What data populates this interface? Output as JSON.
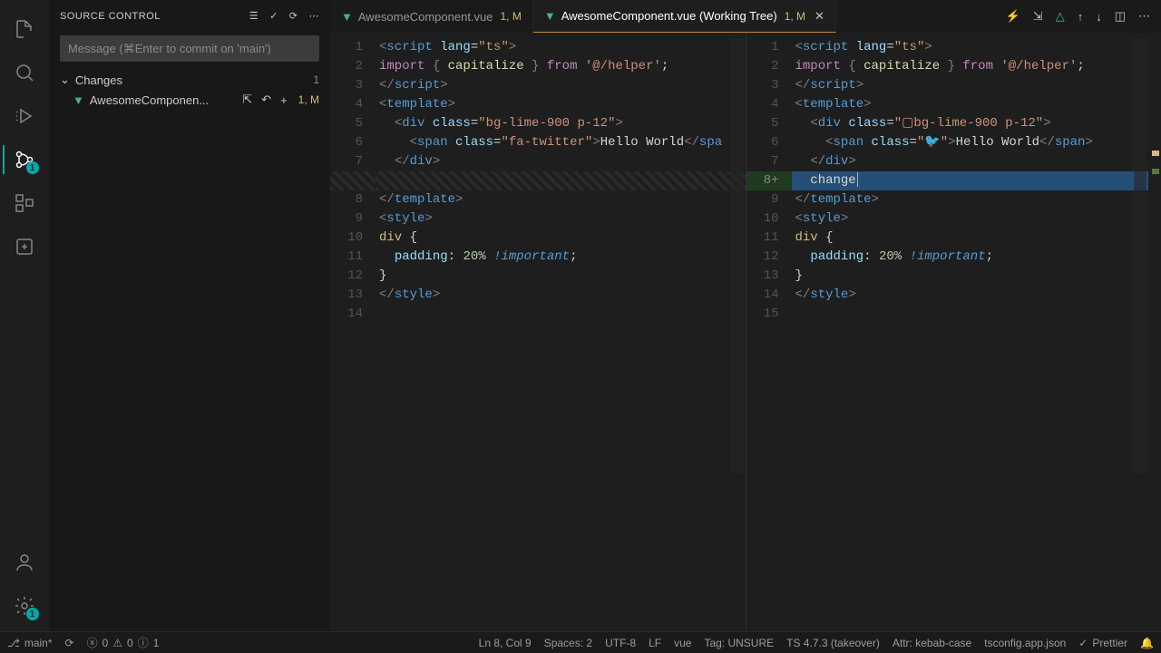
{
  "sidebar": {
    "title": "SOURCE CONTROL",
    "commit_placeholder": "Message (⌘Enter to commit on 'main')",
    "section_label": "Changes",
    "section_count": "1",
    "file_name": "AwesomeComponen...",
    "file_badges": "1, M"
  },
  "tabs": {
    "left": {
      "name": "AwesomeComponent.vue",
      "badges": "1, M"
    },
    "right": {
      "name": "AwesomeComponent.vue (Working Tree)",
      "badges": "1, M"
    }
  },
  "linenos_left": [
    "1",
    "2",
    "3",
    "4",
    "5",
    "6",
    "7",
    "",
    "8",
    "9",
    "10",
    "11",
    "12",
    "13",
    "14"
  ],
  "linenos_right": [
    "1",
    "2",
    "3",
    "4",
    "5",
    "6",
    "7",
    "8+",
    "9",
    "10",
    "11",
    "12",
    "13",
    "14",
    "15"
  ],
  "code_left": {
    "l1": [
      {
        "c": "br",
        "t": "<"
      },
      {
        "c": "tag",
        "t": "script "
      },
      {
        "c": "attr",
        "t": "lang"
      },
      {
        "c": "op",
        "t": "="
      },
      {
        "c": "str",
        "t": "\"ts\""
      },
      {
        "c": "br",
        "t": ">"
      }
    ],
    "l2": [
      {
        "c": "kw",
        "t": "import "
      },
      {
        "c": "br",
        "t": "{ "
      },
      {
        "c": "fn",
        "t": "capitalize"
      },
      {
        "c": "br",
        "t": " } "
      },
      {
        "c": "kw",
        "t": "from "
      },
      {
        "c": "str",
        "t": "'@/helper'"
      },
      {
        "c": "op",
        "t": ";"
      }
    ],
    "l3": [
      {
        "c": "br",
        "t": "</"
      },
      {
        "c": "tag",
        "t": "script"
      },
      {
        "c": "br",
        "t": ">"
      }
    ],
    "l4": [
      {
        "c": "br",
        "t": "<"
      },
      {
        "c": "tag",
        "t": "template"
      },
      {
        "c": "br",
        "t": ">"
      }
    ],
    "l5": [
      {
        "c": "txt",
        "t": "  "
      },
      {
        "c": "br",
        "t": "<"
      },
      {
        "c": "tag",
        "t": "div "
      },
      {
        "c": "attr",
        "t": "class"
      },
      {
        "c": "op",
        "t": "="
      },
      {
        "c": "str",
        "t": "\"bg-lime-900 p-12\""
      },
      {
        "c": "br",
        "t": ">"
      }
    ],
    "l6": [
      {
        "c": "txt",
        "t": "    "
      },
      {
        "c": "br",
        "t": "<"
      },
      {
        "c": "tag",
        "t": "span "
      },
      {
        "c": "attr",
        "t": "class"
      },
      {
        "c": "op",
        "t": "="
      },
      {
        "c": "str",
        "t": "\"fa-twitter\""
      },
      {
        "c": "br",
        "t": ">"
      },
      {
        "c": "txt",
        "t": "Hello World"
      },
      {
        "c": "br",
        "t": "</"
      },
      {
        "c": "tag",
        "t": "spa"
      }
    ],
    "l7": [
      {
        "c": "txt",
        "t": "  "
      },
      {
        "c": "br",
        "t": "</"
      },
      {
        "c": "tag",
        "t": "div"
      },
      {
        "c": "br",
        "t": ">"
      }
    ],
    "l8": [
      {
        "c": "br",
        "t": "</"
      },
      {
        "c": "tag",
        "t": "template"
      },
      {
        "c": "br",
        "t": ">"
      }
    ],
    "l9": [
      {
        "c": "br",
        "t": "<"
      },
      {
        "c": "tag",
        "t": "style"
      },
      {
        "c": "br",
        "t": ">"
      }
    ],
    "l10": [
      {
        "c": "sel",
        "t": "div"
      },
      {
        "c": "txt",
        "t": " {"
      }
    ],
    "l11": [
      {
        "c": "txt",
        "t": "  "
      },
      {
        "c": "attr",
        "t": "padding"
      },
      {
        "c": "txt",
        "t": ": "
      },
      {
        "c": "num",
        "t": "20%"
      },
      {
        "c": "txt",
        "t": " "
      },
      {
        "c": "imp",
        "t": "!important"
      },
      {
        "c": "txt",
        "t": ";"
      }
    ],
    "l12": [
      {
        "c": "txt",
        "t": "}"
      }
    ],
    "l13": [
      {
        "c": "br",
        "t": "</"
      },
      {
        "c": "tag",
        "t": "style"
      },
      {
        "c": "br",
        "t": ">"
      }
    ],
    "l14": [
      {
        "c": "txt",
        "t": ""
      }
    ]
  },
  "code_right": {
    "l1": [
      {
        "c": "br",
        "t": "<"
      },
      {
        "c": "tag",
        "t": "script "
      },
      {
        "c": "attr",
        "t": "lang"
      },
      {
        "c": "op",
        "t": "="
      },
      {
        "c": "str",
        "t": "\"ts\""
      },
      {
        "c": "br",
        "t": ">"
      }
    ],
    "l2": [
      {
        "c": "kw",
        "t": "import "
      },
      {
        "c": "br",
        "t": "{ "
      },
      {
        "c": "fn",
        "t": "capitalize"
      },
      {
        "c": "br",
        "t": " } "
      },
      {
        "c": "kw",
        "t": "from "
      },
      {
        "c": "str",
        "t": "'@/helper'"
      },
      {
        "c": "op",
        "t": ";"
      }
    ],
    "l3": [
      {
        "c": "br",
        "t": "</"
      },
      {
        "c": "tag",
        "t": "script"
      },
      {
        "c": "br",
        "t": ">"
      }
    ],
    "l4": [
      {
        "c": "br",
        "t": "<"
      },
      {
        "c": "tag",
        "t": "template"
      },
      {
        "c": "br",
        "t": ">"
      }
    ],
    "l5": [
      {
        "c": "txt",
        "t": "  "
      },
      {
        "c": "br",
        "t": "<"
      },
      {
        "c": "tag",
        "t": "div "
      },
      {
        "c": "attr",
        "t": "class"
      },
      {
        "c": "op",
        "t": "="
      },
      {
        "c": "str",
        "t": "\"▢bg-lime-900 p-12\""
      },
      {
        "c": "br",
        "t": ">"
      }
    ],
    "l6": [
      {
        "c": "txt",
        "t": "    "
      },
      {
        "c": "br",
        "t": "<"
      },
      {
        "c": "tag",
        "t": "span "
      },
      {
        "c": "attr",
        "t": "class"
      },
      {
        "c": "op",
        "t": "="
      },
      {
        "c": "str",
        "t": "\"🐦\""
      },
      {
        "c": "br",
        "t": ">"
      },
      {
        "c": "txt",
        "t": "Hello World"
      },
      {
        "c": "br",
        "t": "</"
      },
      {
        "c": "tag",
        "t": "span"
      },
      {
        "c": "br",
        "t": ">"
      }
    ],
    "l7": [
      {
        "c": "txt",
        "t": "  "
      },
      {
        "c": "br",
        "t": "</"
      },
      {
        "c": "tag",
        "t": "div"
      },
      {
        "c": "br",
        "t": ">"
      }
    ],
    "l8": [
      {
        "c": "txt",
        "t": "  change"
      }
    ],
    "l9": [
      {
        "c": "br",
        "t": "</"
      },
      {
        "c": "tag",
        "t": "template"
      },
      {
        "c": "br",
        "t": ">"
      }
    ],
    "l10": [
      {
        "c": "br",
        "t": "<"
      },
      {
        "c": "tag",
        "t": "style"
      },
      {
        "c": "br",
        "t": ">"
      }
    ],
    "l11": [
      {
        "c": "sel",
        "t": "div"
      },
      {
        "c": "txt",
        "t": " {"
      }
    ],
    "l12": [
      {
        "c": "txt",
        "t": "  "
      },
      {
        "c": "attr",
        "t": "padding"
      },
      {
        "c": "txt",
        "t": ": "
      },
      {
        "c": "num",
        "t": "20%"
      },
      {
        "c": "txt",
        "t": " "
      },
      {
        "c": "imp",
        "t": "!important"
      },
      {
        "c": "txt",
        "t": ";"
      }
    ],
    "l13": [
      {
        "c": "txt",
        "t": "}"
      }
    ],
    "l14": [
      {
        "c": "br",
        "t": "</"
      },
      {
        "c": "tag",
        "t": "style"
      },
      {
        "c": "br",
        "t": ">"
      }
    ],
    "l15": [
      {
        "c": "txt",
        "t": ""
      }
    ]
  },
  "statusbar": {
    "branch": "main*",
    "errors": "0",
    "warnings": "0",
    "hints": "1",
    "cursor": "Ln 8, Col 9",
    "spaces": "Spaces: 2",
    "encoding": "UTF-8",
    "eol": "LF",
    "lang": "vue",
    "tag": "Tag: UNSURE",
    "ts": "TS 4.7.3 (takeover)",
    "attr": "Attr: kebab-case",
    "tsconfig": "tsconfig.app.json",
    "prettier": "Prettier"
  },
  "activity_badge": "1"
}
